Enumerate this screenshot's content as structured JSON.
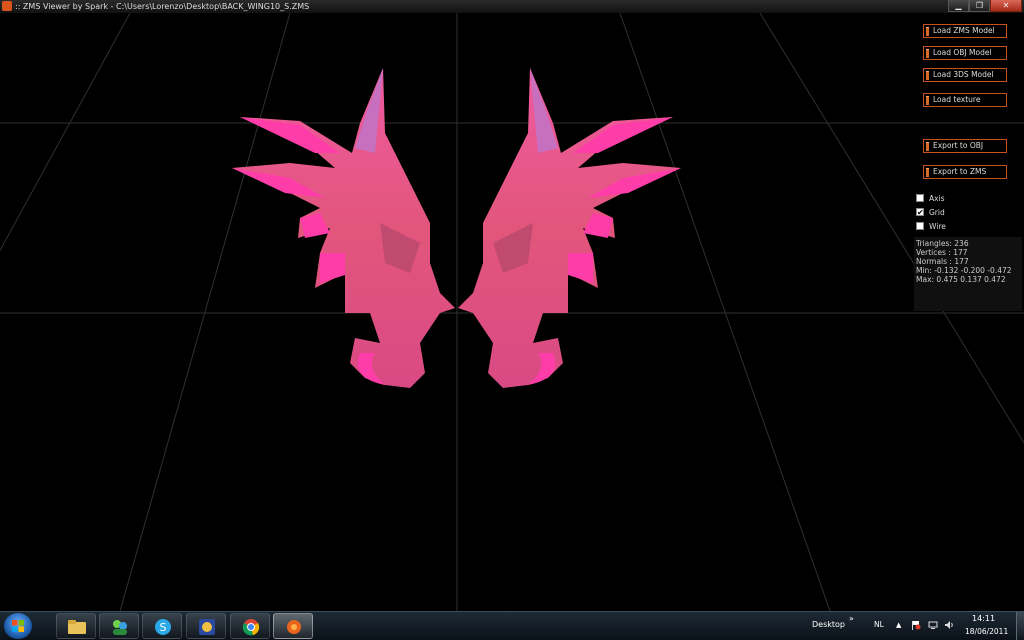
{
  "window": {
    "title": ":: ZMS Viewer by Spark - C:\\Users\\Lorenzo\\Desktop\\BACK_WING10_S.ZMS",
    "controls": {
      "minimize": "▁",
      "maximize": "❐",
      "close": "✕"
    }
  },
  "panel": {
    "buttons": [
      {
        "label": "Load ZMS Model"
      },
      {
        "label": "Load OBJ Model"
      },
      {
        "label": "Load 3DS Model"
      },
      {
        "label": "Load texture"
      },
      {
        "label": "Export to OBJ"
      },
      {
        "label": "Export to ZMS"
      }
    ],
    "checkboxes": [
      {
        "label": "Axis",
        "checked": false
      },
      {
        "label": "Grid",
        "checked": true
      },
      {
        "label": "Wire",
        "checked": false
      }
    ],
    "stats": {
      "triangles": "Triangles: 236",
      "vertices": "Vertices : 177",
      "normals": "Normals : 177",
      "min": "Min: -0.132 -0.200 -0.472",
      "max": "Max: 0.475 0.137 0.472"
    }
  },
  "taskbar": {
    "apps": [
      {
        "icon": "folder-icon"
      },
      {
        "icon": "messenger-icon"
      },
      {
        "icon": "skype-icon"
      },
      {
        "icon": "game-icon"
      },
      {
        "icon": "chrome-icon"
      },
      {
        "icon": "zms-viewer-icon",
        "active": true
      }
    ],
    "toolbar_label": "Desktop",
    "toolbar_chevron": "»",
    "language": "NL",
    "tray_up": "▲",
    "time": "14:11",
    "date": "18/06/2011"
  },
  "colors": {
    "button_border": "#c8521c",
    "wing_pink": "#e85a8e",
    "wing_magenta": "#ff3da8",
    "grid_line": "#3a3a3a"
  }
}
